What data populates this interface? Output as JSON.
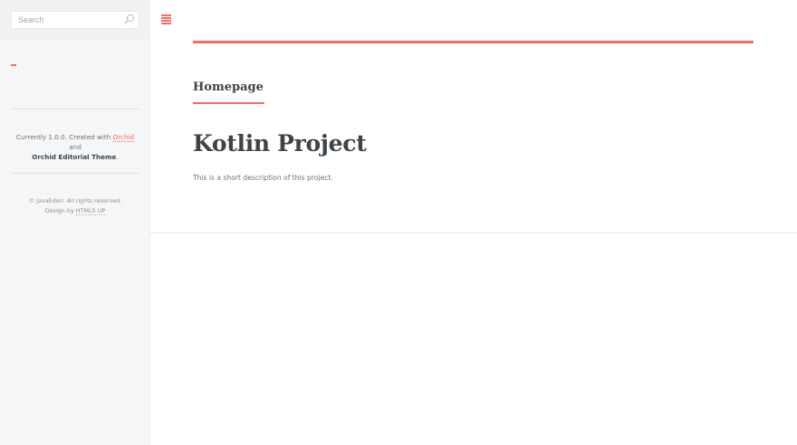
{
  "search": {
    "placeholder": "Search",
    "icon": "search-icon"
  },
  "sidebar": {
    "version_prefix": "Currently 1.0.0. Created with",
    "orchid_link": "Orchid",
    "and_text": "and",
    "theme_name": "Orchid Editorial Theme",
    "period": ".",
    "copyright_text": "© JavaEden. All rights reserved.",
    "design_prefix": "Design by",
    "design_link": "HTML5 UP"
  },
  "header": {
    "menu_icon": "hamburger-menu-icon"
  },
  "main": {
    "section_label": "Homepage",
    "title": "Kotlin Project",
    "description": "This is a short description of this project."
  },
  "colors": {
    "accent": "#f56a6a",
    "text": "#3d4449",
    "sidebar_bg": "#f5f6f7"
  }
}
